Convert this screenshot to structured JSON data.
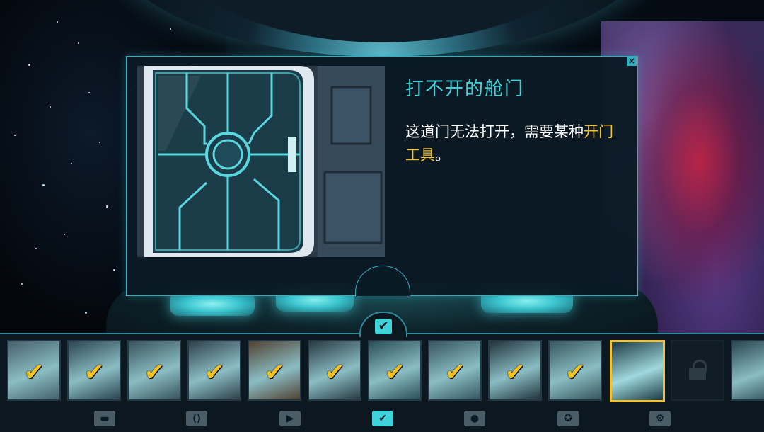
{
  "info_panel": {
    "title": "打不开的舱门",
    "description_prefix": "这道门无法打开，需要某种",
    "description_highlight": "开门工具",
    "description_suffix": "。",
    "close_icon": "×"
  },
  "checkmark_glyph": "✔",
  "collection": {
    "tab_check_icon": "✔",
    "items": [
      {
        "art": "crab-robot-thumb",
        "checked": true
      },
      {
        "art": "conveyor-thumb",
        "checked": true
      },
      {
        "art": "platform-thumb",
        "checked": true
      },
      {
        "art": "dish-thumb",
        "checked": true
      },
      {
        "art": "cabinet-thumb",
        "checked": true
      },
      {
        "art": "claw-thumb",
        "checked": true
      },
      {
        "art": "monitor-thumb",
        "checked": true
      },
      {
        "art": "panel-thumb",
        "checked": true
      },
      {
        "art": "keycard-thumb",
        "checked": true
      },
      {
        "art": "capsule-thumb",
        "checked": true
      },
      {
        "art": "door-thumb",
        "checked": false,
        "selected": true
      },
      {
        "art": "lock-icon",
        "locked": true
      },
      {
        "art": "partial-thumb",
        "checked": false
      }
    ]
  },
  "nav": [
    {
      "icon": "inventory-icon",
      "glyph": "▬"
    },
    {
      "icon": "code-icon",
      "glyph": "⟨⟩"
    },
    {
      "icon": "play-icon",
      "glyph": "▶"
    },
    {
      "icon": "check-icon",
      "glyph": "✔",
      "active": true
    },
    {
      "icon": "hint-bulb-icon",
      "glyph": "●"
    },
    {
      "icon": "achievement-icon",
      "glyph": "✪"
    },
    {
      "icon": "settings-gear-icon",
      "glyph": "⚙"
    }
  ],
  "colors": {
    "accent": "#3fd2d8",
    "highlight": "#f2c230",
    "panel_border": "#2fb0c0"
  }
}
